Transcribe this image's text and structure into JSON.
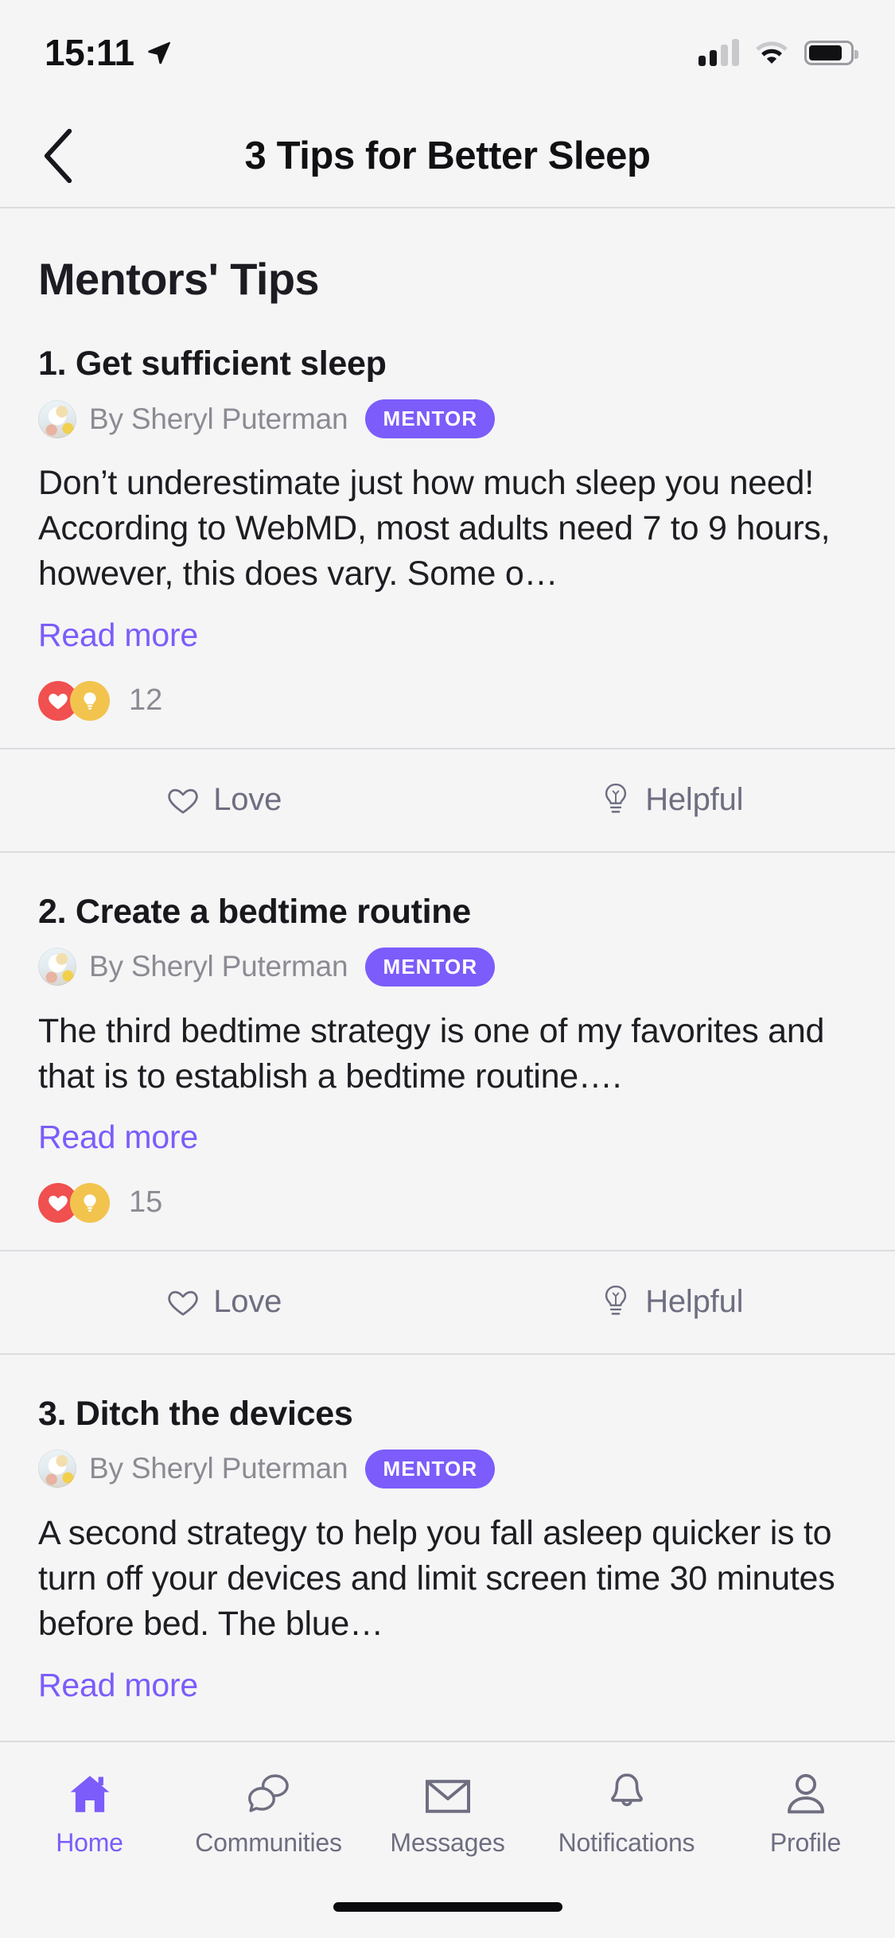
{
  "status_bar": {
    "time": "15:11",
    "location_icon": "location-arrow-icon",
    "signal_icon": "cellular-signal-icon",
    "signal_bars_filled": 2,
    "signal_bars_total": 4,
    "wifi_icon": "wifi-icon",
    "battery_icon": "battery-icon",
    "battery_level_percent": 82
  },
  "nav": {
    "back_icon": "chevron-left-icon",
    "title": "3 Tips for Better Sleep"
  },
  "section": {
    "title": "Mentors' Tips"
  },
  "colors": {
    "accent_purple": "#7c5cfa",
    "love_red": "#f0504f",
    "helpful_yellow": "#f2c44e",
    "muted_text": "#8b8b93",
    "background": "#f5f5f6",
    "divider": "#dcdce0"
  },
  "actions": {
    "love_label": "Love",
    "love_icon": "heart-outline-icon",
    "helpful_label": "Helpful",
    "helpful_icon": "lightbulb-outline-icon"
  },
  "read_more_label": "Read more",
  "tips": [
    {
      "title": "1. Get sufficient sleep",
      "author_prefix": "By",
      "author": "By Sheryl Puterman",
      "badge": "MENTOR",
      "avatar_icon": "user-avatar-photo",
      "body": "Don’t underestimate just how much sleep you need! According to WebMD, most adults need 7 to 9 hours, however, this does vary. Some o…",
      "read_more": "Read more",
      "reaction_count": "12",
      "reaction_icons": [
        "heart-filled-icon",
        "lightbulb-filled-icon"
      ],
      "has_action_bar": true
    },
    {
      "title": "2. Create a bedtime routine",
      "author_prefix": "By",
      "author": "By Sheryl Puterman",
      "badge": "MENTOR",
      "avatar_icon": "user-avatar-photo",
      "body": "The third bedtime strategy is one of my favorites and that is to establish a bedtime routine….",
      "read_more": "Read more",
      "reaction_count": "15",
      "reaction_icons": [
        "heart-filled-icon",
        "lightbulb-filled-icon"
      ],
      "has_action_bar": true
    },
    {
      "title": "3. Ditch the devices",
      "author_prefix": "By",
      "author": "By Sheryl Puterman",
      "badge": "MENTOR",
      "avatar_icon": "user-avatar-photo",
      "body": "A second strategy to help you fall asleep quicker is to turn off your devices and limit screen time 30 minutes before bed. The blue…",
      "read_more": "Read more",
      "reaction_count": "",
      "reaction_icons": [],
      "has_action_bar": false
    }
  ],
  "tabbar": {
    "items": [
      {
        "label": "Home",
        "icon": "home-icon",
        "active": true
      },
      {
        "label": "Communities",
        "icon": "chat-bubbles-icon",
        "active": false
      },
      {
        "label": "Messages",
        "icon": "envelope-icon",
        "active": false
      },
      {
        "label": "Notifications",
        "icon": "bell-icon",
        "active": false
      },
      {
        "label": "Profile",
        "icon": "person-icon",
        "active": false
      }
    ]
  }
}
